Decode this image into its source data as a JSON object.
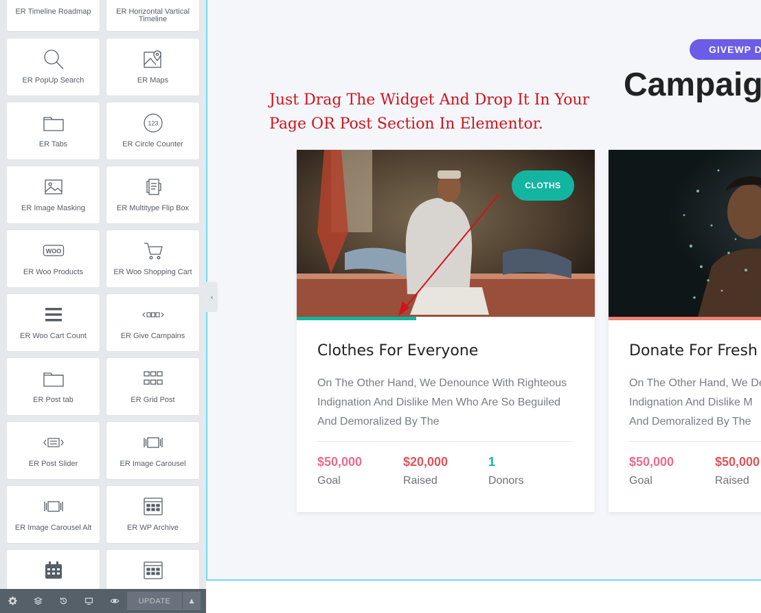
{
  "sidebar": {
    "widgets": [
      {
        "label": "ER Timeline Roadmap",
        "icon": "timeline-roadmap-icon"
      },
      {
        "label": "ER Horizontal Vartical Timeline",
        "icon": "horizontal-timeline-icon"
      },
      {
        "label": "ER PopUp Search",
        "icon": "search-icon"
      },
      {
        "label": "ER Maps",
        "icon": "map-icon"
      },
      {
        "label": "ER Tabs",
        "icon": "tabs-icon"
      },
      {
        "label": "ER Circle Counter",
        "icon": "circle-counter-icon"
      },
      {
        "label": "ER Image Masking",
        "icon": "image-icon"
      },
      {
        "label": "ER Multitype Flip Box",
        "icon": "flip-box-icon"
      },
      {
        "label": "ER Woo Products",
        "icon": "woo-icon"
      },
      {
        "label": "ER Woo Shopping Cart",
        "icon": "cart-icon"
      },
      {
        "label": "ER Woo Cart Count",
        "icon": "menu-bars-icon"
      },
      {
        "label": "ER Give Campains",
        "icon": "give-campaigns-icon"
      },
      {
        "label": "ER Post tab",
        "icon": "tabs-icon"
      },
      {
        "label": "ER Grid Post",
        "icon": "grid-icon"
      },
      {
        "label": "ER Post Slider",
        "icon": "post-slider-icon"
      },
      {
        "label": "ER Image Carousel",
        "icon": "carousel-icon"
      },
      {
        "label": "ER Image Carousel Alt",
        "icon": "carousel-icon"
      },
      {
        "label": "ER WP Archive",
        "icon": "archive-icon"
      },
      {
        "label": "",
        "icon": "calendar-icon"
      },
      {
        "label": "",
        "icon": "archive-icon"
      }
    ],
    "circle_counter_text": "123",
    "woo_text": "WOO"
  },
  "toolbar": {
    "update_label": "UPDATE",
    "icons": [
      "gear-icon",
      "layers-icon",
      "history-icon",
      "responsive-icon",
      "preview-eye-icon"
    ]
  },
  "canvas": {
    "badge": "GIVEWP DO",
    "heading": "Campaign",
    "instruction": "Just Drag The Widget And Drop It In Your Page OR Post Section In Elementor.",
    "cards": [
      {
        "tag": "CLOTHS",
        "title": "Clothes For Everyone",
        "description_lines": [
          "On The Other Hand, We Denounce With Righteous",
          "Indignation And Dislike Men Who Are So Beguiled",
          "And Demoralized By The"
        ],
        "progress": 0.4,
        "progress_color": "#13b5a1",
        "goal_value": "$50,000",
        "goal_label": "Goal",
        "raised_value": "$20,000",
        "raised_label": "Raised",
        "donors_value": "1",
        "donors_label": "Donors"
      },
      {
        "title": "Donate For Fresh W",
        "description_lines": [
          "On The Other Hand, We De",
          "Indignation And Dislike M",
          "And Demoralized By The"
        ],
        "progress": 1.0,
        "progress_color": "#f0806f",
        "goal_value": "$50,000",
        "goal_label": "Goal",
        "raised_value": "$50,000",
        "raised_label": "Raised"
      }
    ]
  },
  "colors": {
    "goal": "#e96b8c",
    "raised": "#e0535a",
    "donors": "#13b5a1",
    "badge": "#6c5ce7",
    "instruction": "#d0131b"
  }
}
